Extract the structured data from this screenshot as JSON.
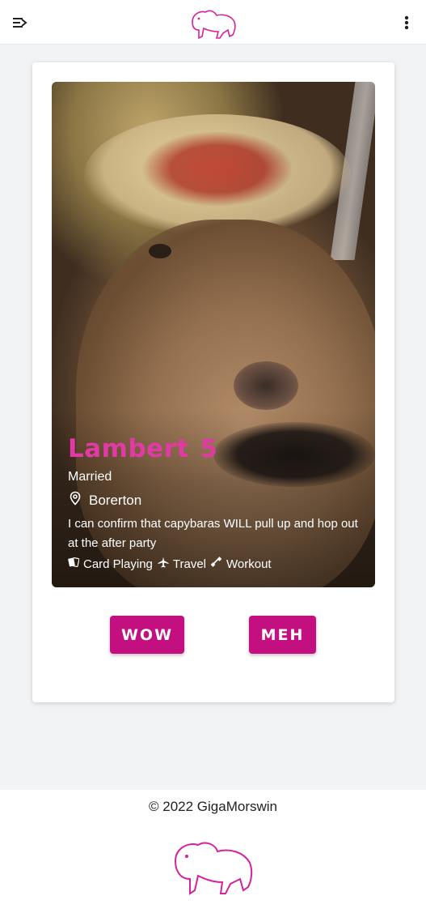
{
  "colors": {
    "brand": "#c40f80",
    "name_accent": "#e23aa4",
    "logo_stroke": "#d6229a"
  },
  "header": {
    "menu_icon": "menu-open-icon",
    "logo_icon": "capybara-logo",
    "more_icon": "more-vert-icon"
  },
  "profile": {
    "name": "Lambert",
    "age": "5",
    "status": "Married",
    "location": "Borerton",
    "bio": "I can confirm that capybaras WILL pull up and hop out at the after party",
    "interests": [
      {
        "icon": "cards-icon",
        "label": "Card Playing"
      },
      {
        "icon": "airplane-icon",
        "label": "Travel"
      },
      {
        "icon": "dumbbell-icon",
        "label": "Workout"
      }
    ]
  },
  "actions": {
    "wow_label": "WOW",
    "meh_label": "MEH"
  },
  "footer": {
    "copyright": "© 2022 GigaMorswin"
  }
}
